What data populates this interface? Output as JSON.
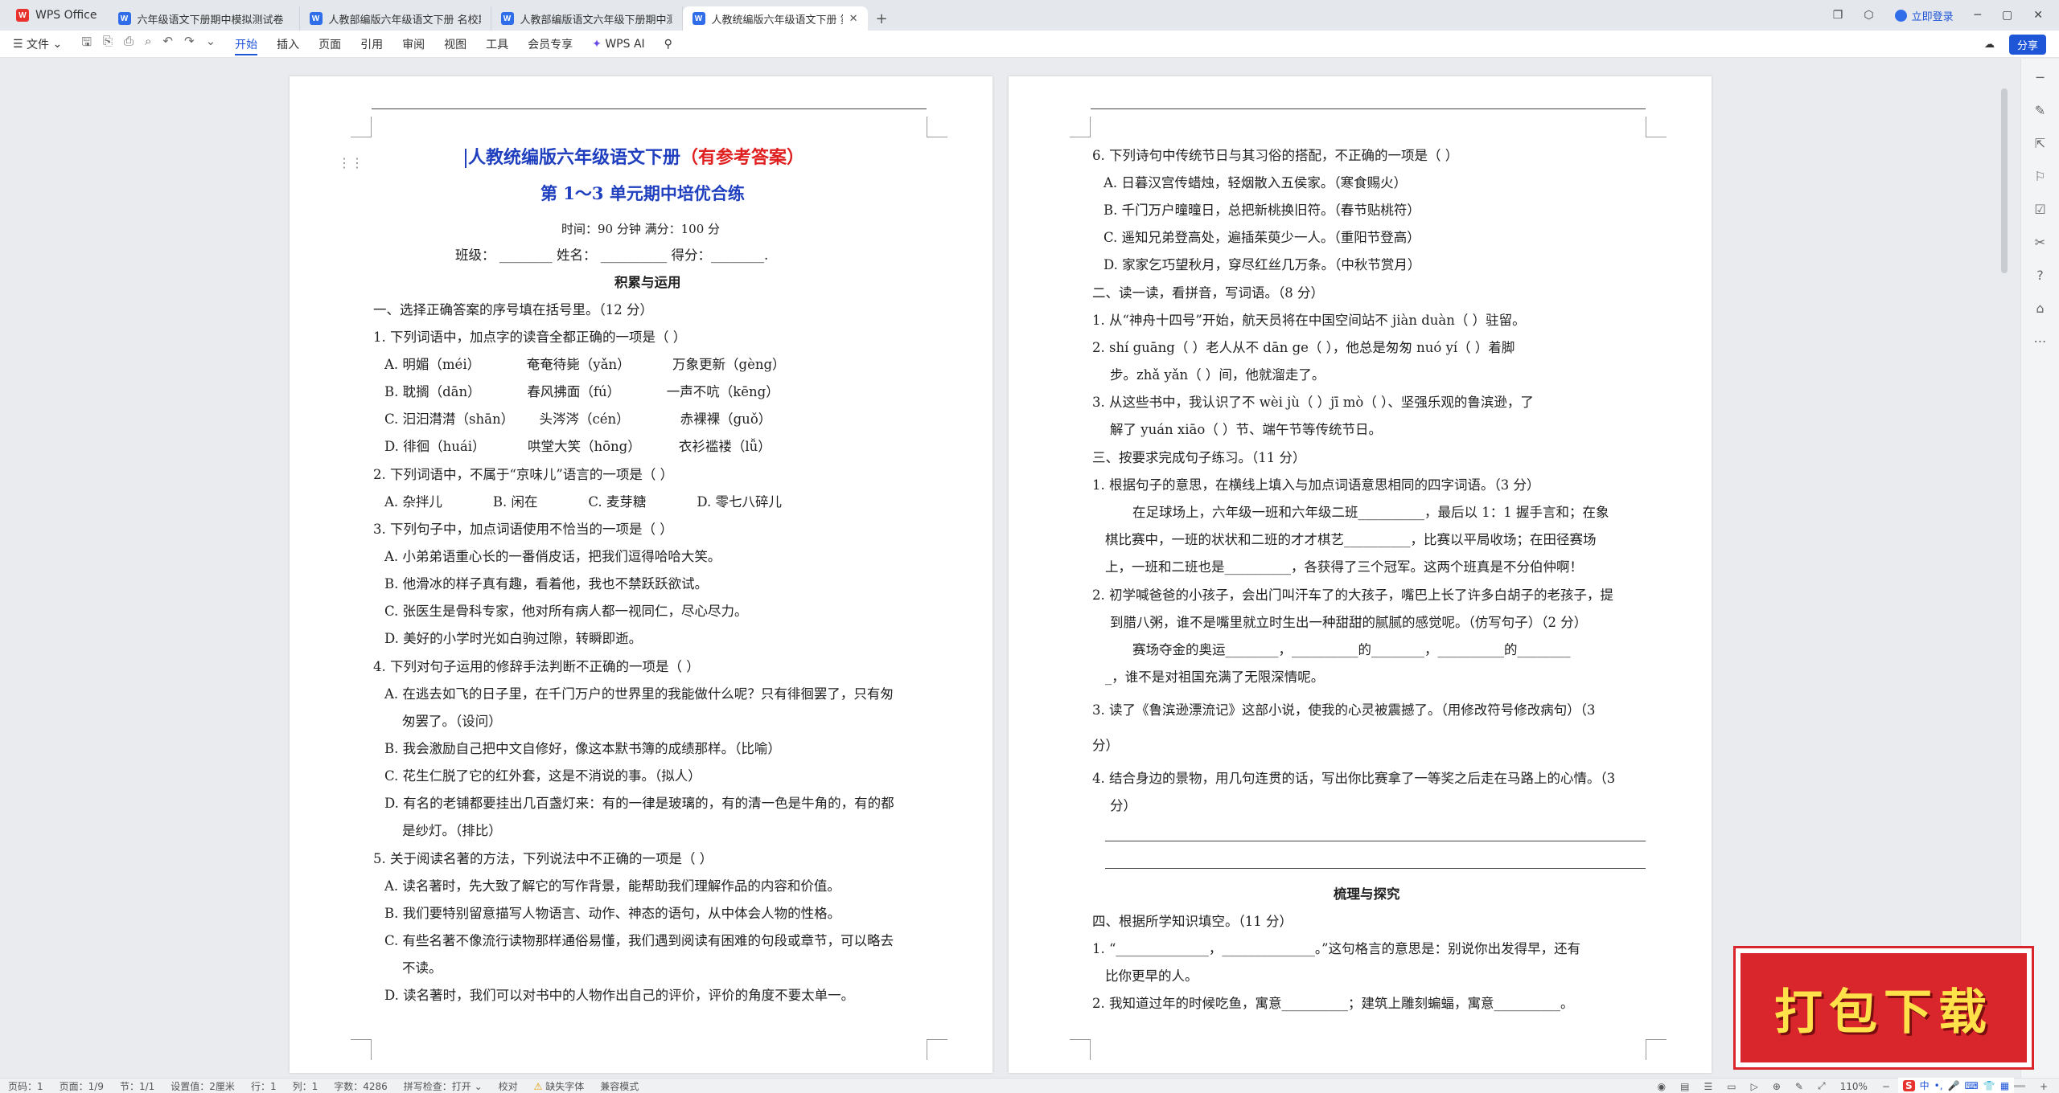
{
  "tabs": {
    "home": "WPS Office",
    "docs": [
      {
        "label": "六年级语文下册期中模拟测试卷（六",
        "active": false
      },
      {
        "label": "人教部编版六年级语文下册 名校期中",
        "active": false
      },
      {
        "label": "人教部编版语文六年级下册期中测试",
        "active": false
      },
      {
        "label": "人教统编版六年级语文下册 第",
        "active": true
      }
    ],
    "new_tab": "+",
    "login": "立即登录"
  },
  "menu": {
    "file": "文件",
    "items": [
      "开始",
      "插入",
      "页面",
      "引用",
      "审阅",
      "视图",
      "工具",
      "会员专享"
    ],
    "active": "开始",
    "wps_ai": "WPS AI",
    "share": "分享"
  },
  "page1": {
    "title_blue": "人教统编版六年级语文下册",
    "title_red": "（有参考答案）",
    "subtitle": "第 1～3 单元期中培优合练",
    "time": "时间：90 分钟  满分：100 分",
    "fields": "班级：  ________   姓名：  __________   得分：________.",
    "section": "积累与运用",
    "lines": [
      "一、选择正确答案的序号填在括号里。（12 分）",
      "1. 下列词语中，加点字的读音全都正确的一项是（    ）",
      "A. 明媚（méi）           奄奄待毙（yǎn）          万象更新（gèng）",
      "B. 耽搁（dān）           春风拂面（fú）           一声不吭（kēng）",
      "C. 汩汩潸潸（shān）      头涔涔（cén）            赤裸裸（guǒ）",
      "D. 徘徊（huái）          哄堂大笑（hōng）         衣衫褴褛（lǚ）",
      "2. 下列词语中，不属于“京味儿”语言的一项是（    ）",
      "A. 杂拌儿            B. 闲在            C. 麦芽糖            D. 零七八碎儿",
      "3. 下列句子中，加点词语使用不恰当的一项是（    ）",
      "A. 小弟弟语重心长的一番俏皮话，把我们逗得哈哈大笑。",
      "B. 他滑冰的样子真有趣，看着他，我也不禁跃跃欲试。",
      "C. 张医生是骨科专家，他对所有病人都一视同仁，尽心尽力。",
      "D. 美好的小学时光如白驹过隙，转瞬即逝。",
      "4. 下列对句子运用的修辞手法判断不正确的一项是（    ）",
      "A. 在逃去如飞的日子里，在千门万户的世界里的我能做什么呢？只有徘徊罢了，只有匆",
      "匆罢了。（设问）",
      "B. 我会激励自己把中文自修好，像这本默书簿的成绩那样。（比喻）",
      "C. 花生仁脱了它的红外套，这是不消说的事。（拟人）",
      "D. 有名的老铺都要挂出几百盏灯来：有的一律是玻璃的，有的清一色是牛角的，有的都",
      "是纱灯。（排比）",
      "5. 关于阅读名著的方法，下列说法中不正确的一项是（    ）",
      "A. 读名著时，先大致了解它的写作背景，能帮助我们理解作品的内容和价值。",
      "B. 我们要特别留意描写人物语言、动作、神态的语句，从中体会人物的性格。",
      "C. 有些名著不像流行读物那样通俗易懂，我们遇到阅读有困难的句段或章节，可以略去",
      "不读。",
      "D. 读名著时，我们可以对书中的人物作出自己的评价，评价的角度不要太单一。"
    ]
  },
  "page2": {
    "lines": [
      "6. 下列诗句中传统节日与其习俗的搭配，不正确的一项是（    ）",
      "A. 日暮汉宫传蜡烛，轻烟散入五侯家。（寒食赐火）",
      "B. 千门万户曈曈日，总把新桃换旧符。（春节贴桃符）",
      "C. 遥知兄弟登高处，遍插茱萸少一人。（重阳节登高）",
      "D. 家家乞巧望秋月，穿尽红丝几万条。（中秋节赏月）",
      "二、读一读，看拼音，写词语。（8 分）",
      "1. 从“神舟十四号”开始，航天员将在中国空间站不 jiàn duàn（        ）驻留。",
      "2. shí guāng（        ）老人从不 dān ge（        ），他总是匆匆 nuó yí（        ）着脚",
      "步。zhǎ yǎn（        ）间，他就溜走了。",
      "3. 从这些书中，我认识了不 wèi jù（        ）jī mò（        ）、坚强乐观的鲁滨逊，了",
      "解了 yuán xiāo（        ）节、端午节等传统节日。",
      "三、按要求完成句子练习。（11 分）",
      "1. 根据句子的意思，在横线上填入与加点词语意思相同的四字词语。（3 分）",
      "在足球场上，六年级一班和六年级二班__________，最后以 1：1 握手言和；在象",
      "棋比赛中，一班的状状和二班的才才棋艺__________，比赛以平局收场；在田径赛场",
      "上，一班和二班也是__________，各获得了三个冠军。这两个班真是不分伯仲啊！",
      "2. 初学喊爸爸的小孩子，会出门叫汗车了的大孩子，嘴巴上长了许多白胡子的老孩子，提",
      "到腊八粥，谁不是嘴里就立时生出一种甜甜的腻腻的感觉呢。（仿写句子）（2 分）",
      "赛场夺金的奥运________，__________的________，__________的________",
      "_，谁不是对祖国充满了无限深情呢。",
      "3. 读了《鲁滨逊漂流记》这部小说，使我的心灵被震撼了。（用修改符号修改病句）（3",
      "分）",
      "4. 结合身边的景物，用几句连贯的话，写出你比赛拿了一等奖之后走在马路上的心情。（3",
      "分）"
    ],
    "section": "梳理与探究",
    "tail": [
      "四、根据所学知识填空。（11 分）",
      "1. “______________，______________。”这句格言的意思是：别说你出发得早，还有",
      "比你更早的人。",
      "2. 我知道过年的时候吃鱼，寓意__________；建筑上雕刻蝙蝠，寓意__________。"
    ]
  },
  "status": {
    "page": "页码：1",
    "pages": "页面：1/9",
    "section": "节：1/1",
    "setting": "设置值：2厘米",
    "row": "行：1",
    "col": "列：1",
    "words": "字数：4286",
    "spell": "拼写检查：打开",
    "proof": "校对",
    "missing_font": "缺失字体",
    "compat": "兼容模式",
    "zoom": "110%"
  },
  "banner": {
    "text": "打包下载"
  }
}
